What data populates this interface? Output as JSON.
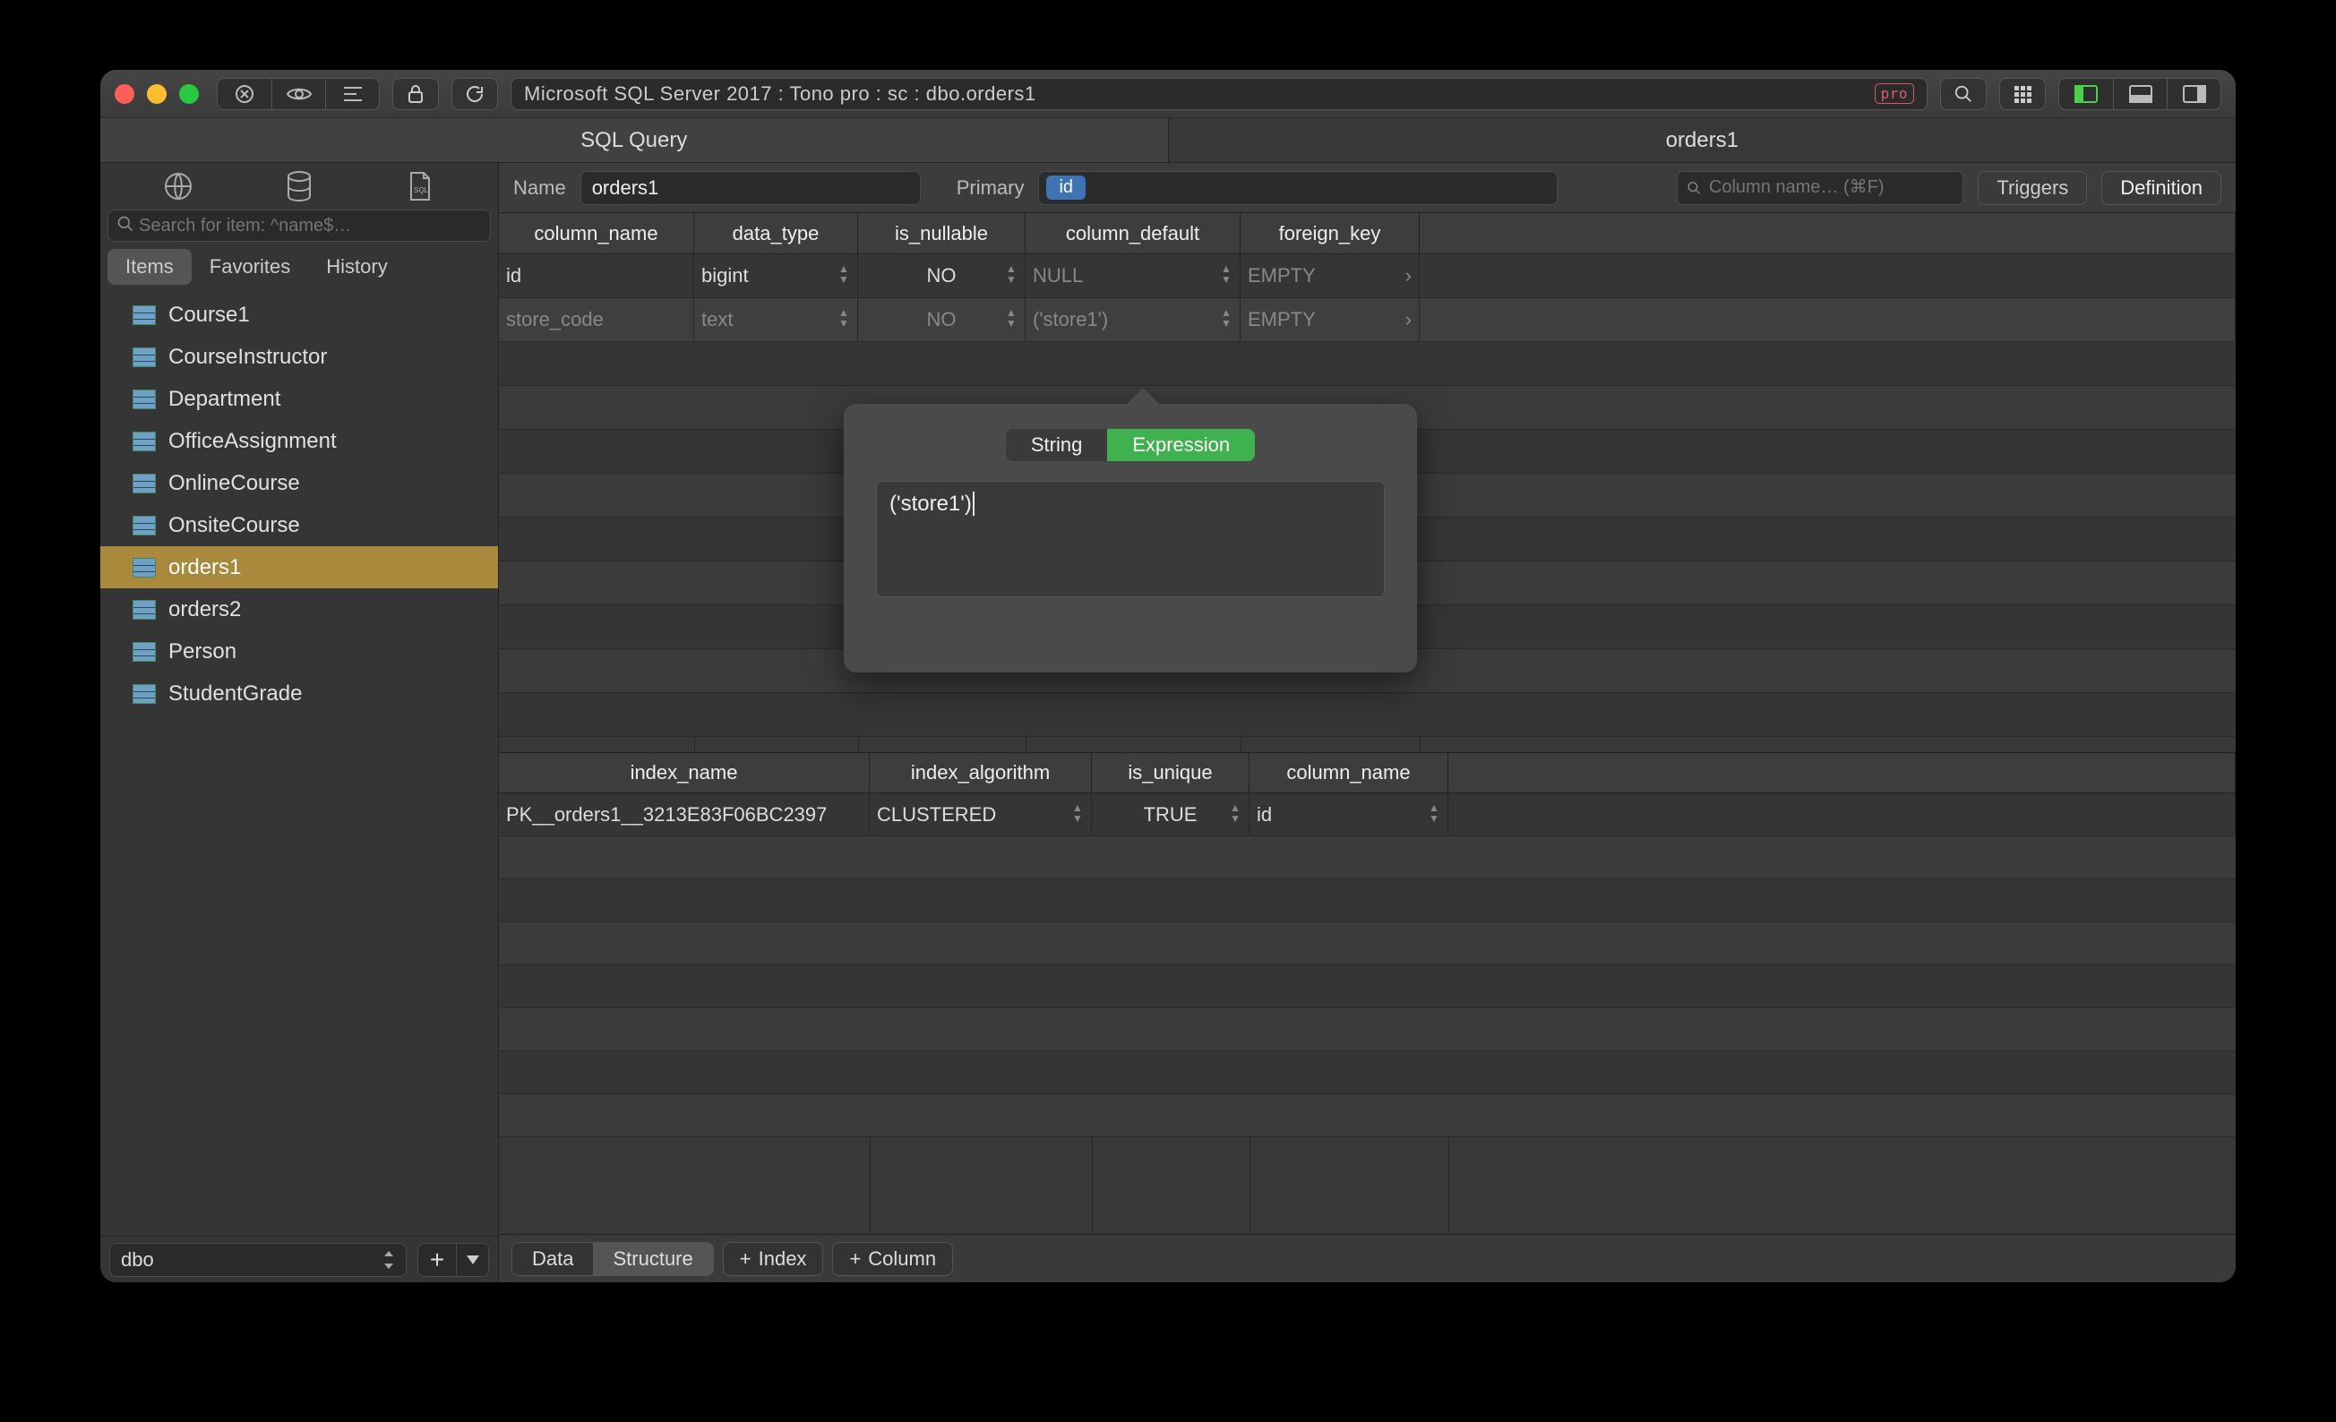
{
  "titlebar": {
    "path": "Microsoft SQL Server 2017 : Tono pro : sc : dbo.orders1",
    "pro_badge": "pro"
  },
  "main_tabs": {
    "sql_query": "SQL Query",
    "table": "orders1"
  },
  "sidebar": {
    "search_placeholder": "Search for item: ^name$…",
    "tabs": {
      "items": "Items",
      "favorites": "Favorites",
      "history": "History"
    },
    "items": [
      "Course1",
      "CourseInstructor",
      "Department",
      "OfficeAssignment",
      "OnlineCourse",
      "OnsiteCourse",
      "orders1",
      "orders2",
      "Person",
      "StudentGrade"
    ],
    "schema": "dbo"
  },
  "infobar": {
    "name_label": "Name",
    "name_value": "orders1",
    "primary_label": "Primary",
    "primary_key": "id",
    "col_search_placeholder": "Column name… (⌘F)",
    "triggers": "Triggers",
    "definition": "Definition"
  },
  "columns": {
    "headers": [
      "column_name",
      "data_type",
      "is_nullable",
      "column_default",
      "foreign_key"
    ],
    "rows": [
      {
        "name": "id",
        "type": "bigint",
        "nullable": "NO",
        "default": "NULL",
        "fk": "EMPTY"
      },
      {
        "name": "store_code",
        "type": "text",
        "nullable": "NO",
        "default": "('store1')",
        "fk": "EMPTY"
      }
    ]
  },
  "indexes": {
    "headers": [
      "index_name",
      "index_algorithm",
      "is_unique",
      "column_name"
    ],
    "rows": [
      {
        "name": "PK__orders1__3213E83F06BC2397",
        "algo": "CLUSTERED",
        "unique": "TRUE",
        "col": "id"
      }
    ]
  },
  "footer": {
    "data": "Data",
    "structure": "Structure",
    "index": "Index",
    "column": "Column"
  },
  "popover": {
    "tab_string": "String",
    "tab_expression": "Expression",
    "value": "('store1')"
  }
}
